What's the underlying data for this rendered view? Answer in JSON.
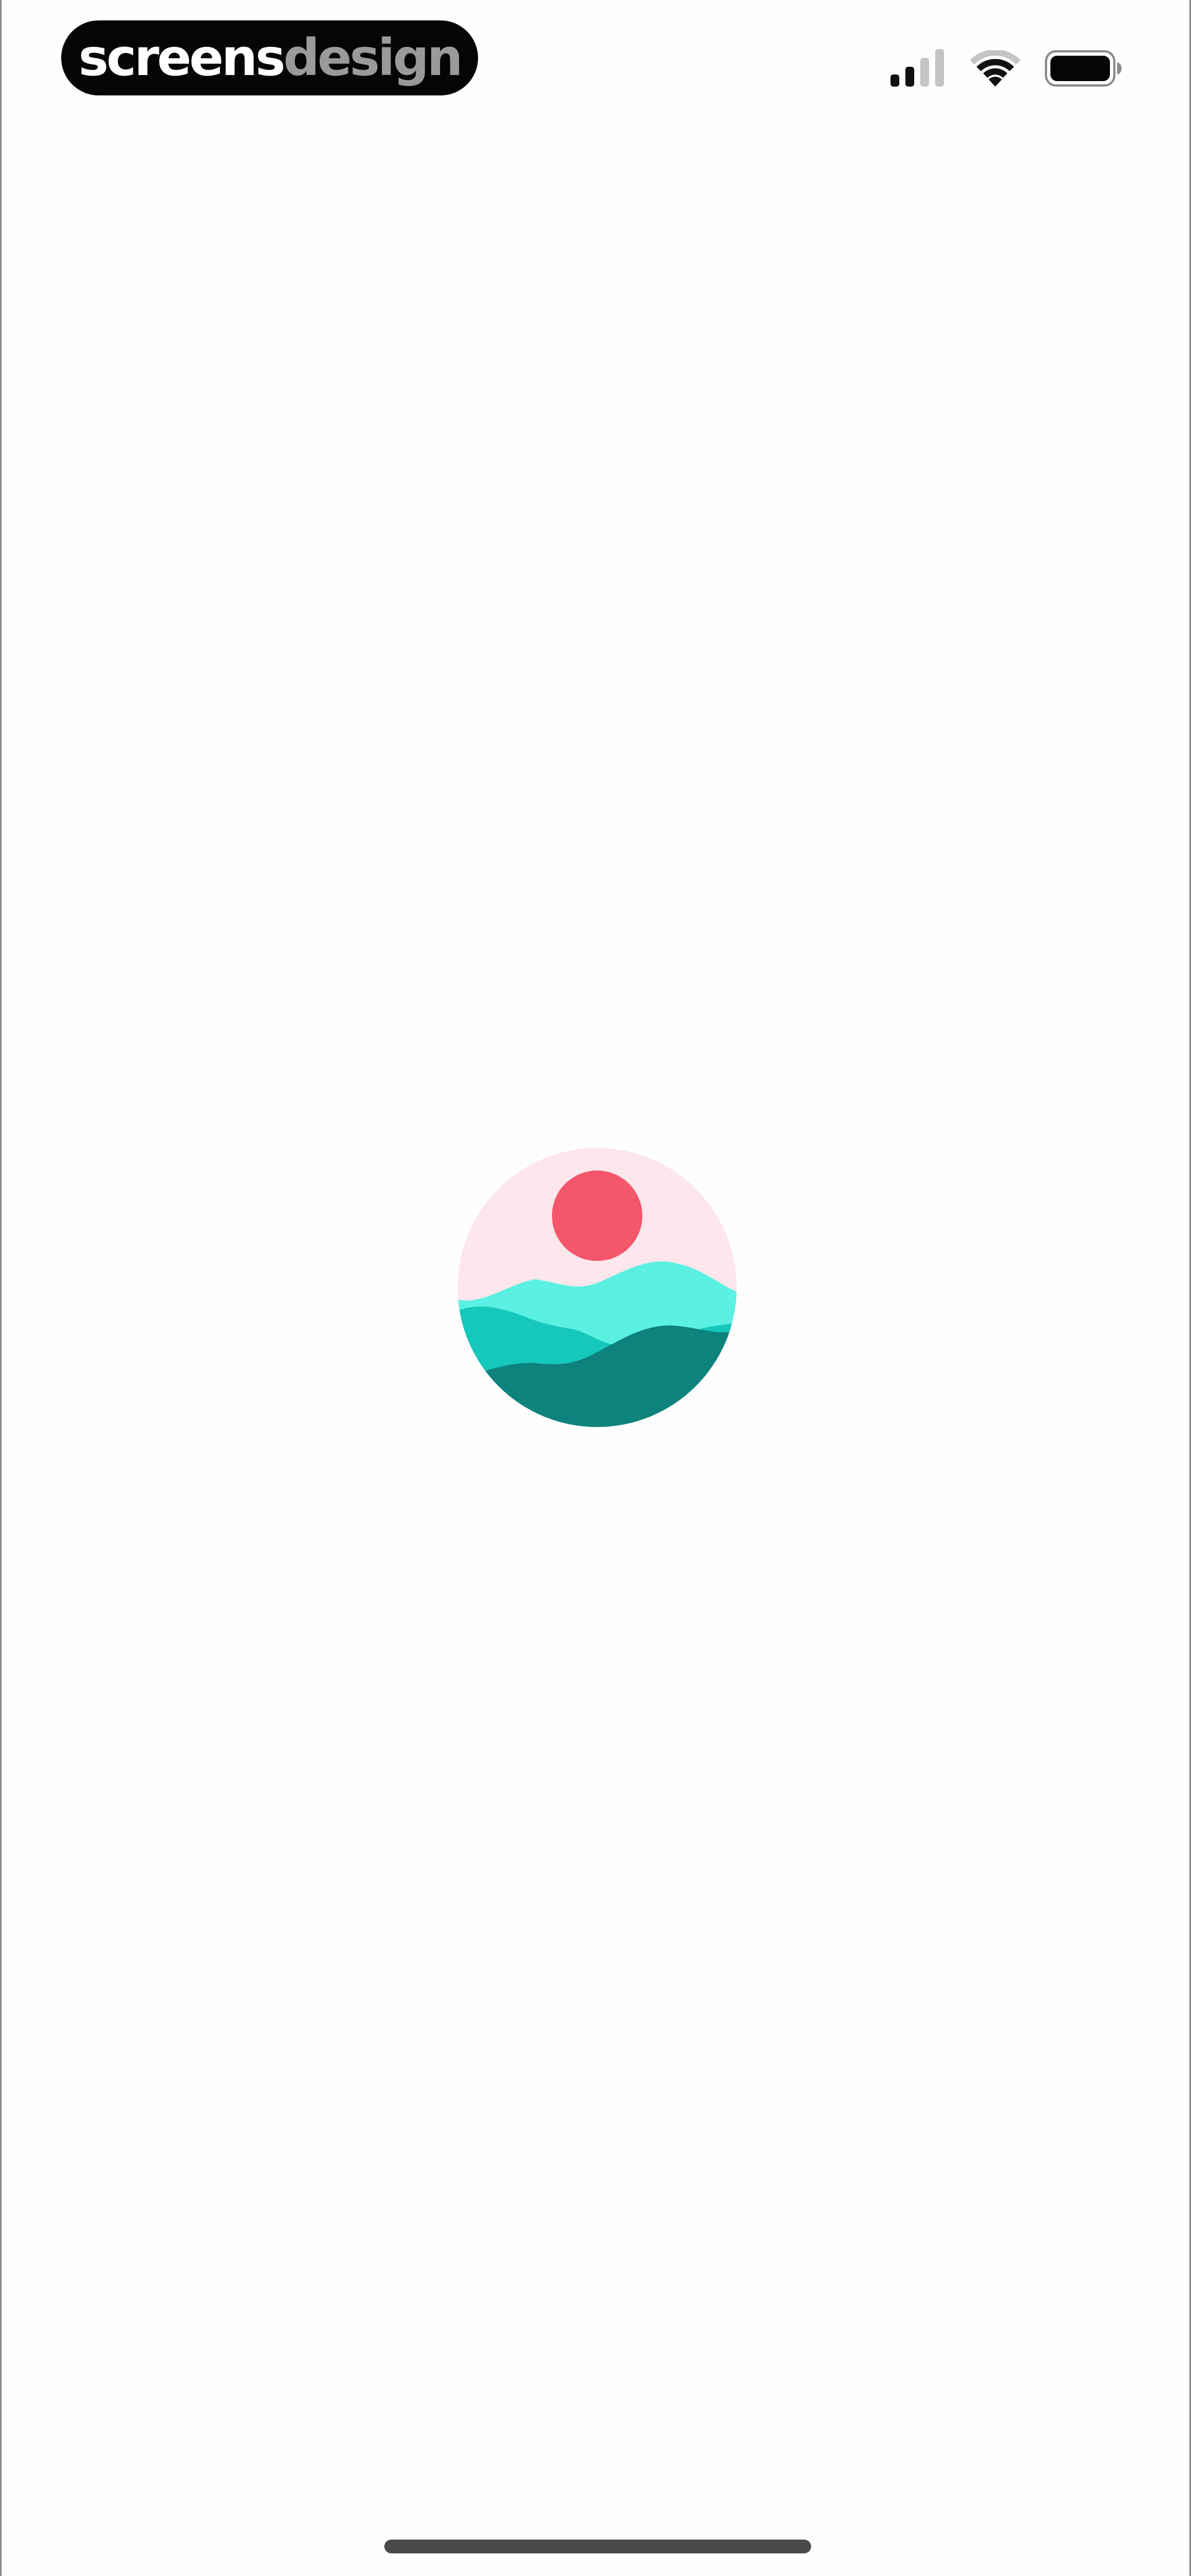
{
  "watermark": {
    "part1": "screens",
    "part2": "design"
  },
  "status_bar": {
    "signal_icon": "cellular-signal-icon",
    "wifi_icon": "wifi-icon",
    "battery_icon": "battery-icon",
    "signal_bars_active": 2,
    "signal_bars_total": 4
  },
  "splash": {
    "logo_icon": "sunset-over-waves-icon",
    "colors": {
      "sky": "#fde6ec",
      "sun": "#f4566b",
      "wave_light": "#5af0e2",
      "wave_mid": "#16c7bb",
      "wave_dark": "#0e827d"
    }
  },
  "home_indicator": {
    "color": "#4a4a4a"
  }
}
